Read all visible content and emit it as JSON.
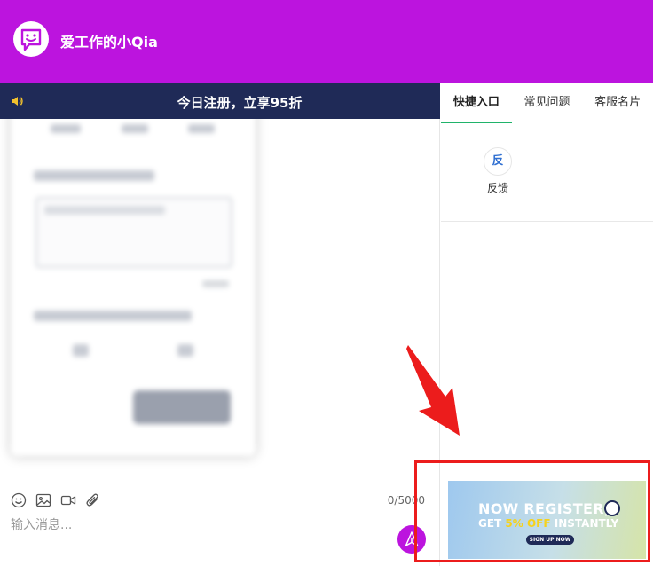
{
  "header": {
    "app_title": "爱工作的小Qia",
    "avatar_icon": "chat-bot-face-icon",
    "background_color": "#bc14de"
  },
  "announcement": {
    "icon": "speaker-icon",
    "text": "今日注册，立享95折",
    "background_color": "#1f2a57"
  },
  "input_bar": {
    "tools": [
      "emoji-icon",
      "image-icon",
      "video-icon",
      "attachment-icon"
    ],
    "char_counter": "0/5000",
    "placeholder": "输入消息...",
    "send_icon": "send-icon"
  },
  "right_panel": {
    "tabs": [
      {
        "label": "快捷入口",
        "active": true
      },
      {
        "label": "常见问题",
        "active": false
      },
      {
        "label": "客服名片",
        "active": false
      }
    ],
    "quick_items": [
      {
        "icon_text": "反",
        "label": "反馈"
      }
    ],
    "active_tab_color": "#20b36a"
  },
  "ad_banner": {
    "line1": "NOW REGISTER,",
    "line2_prefix": "GET ",
    "line2_highlight": "5% OFF",
    "line2_suffix": " INSTANTLY",
    "button_label": "SIGN UP NOW",
    "highlight_color": "#f6d21c"
  },
  "annotation": {
    "color": "#ec1c1c"
  }
}
